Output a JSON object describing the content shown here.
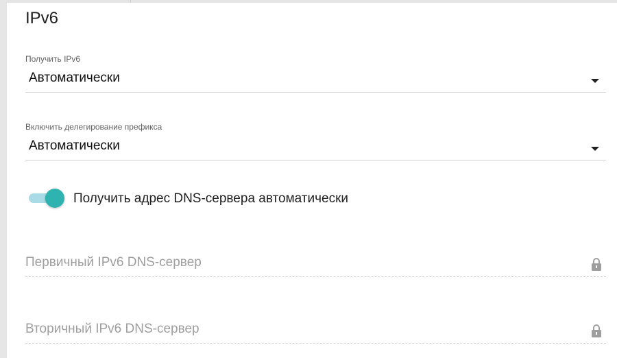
{
  "section": {
    "title": "IPv6"
  },
  "ipv6_mode": {
    "label": "Получить IPv6",
    "value": "Автоматически"
  },
  "prefix_delegation": {
    "label": "Включить делегирование префикса",
    "value": "Автоматически"
  },
  "dns_auto": {
    "label": "Получить адрес DNS-сервера автоматически",
    "enabled": true
  },
  "primary_dns": {
    "placeholder": "Первичный IPv6 DNS-сервер",
    "locked": true
  },
  "secondary_dns": {
    "placeholder": "Вторичный IPv6 DNS-сервер",
    "locked": true
  },
  "colors": {
    "accent": "#2fb3b0",
    "accent_track": "#a9dbe6",
    "placeholder": "#9e9e9e"
  },
  "icons": {
    "caret": "caret-down-icon",
    "lock": "lock-icon"
  }
}
